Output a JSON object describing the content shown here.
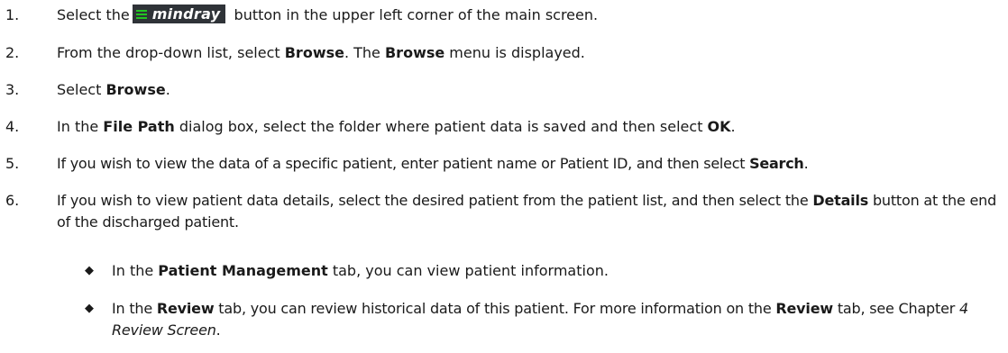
{
  "steps": [
    {
      "num": "1.",
      "pre": "Select the",
      "logo_text": "mindray",
      "post": "button in the upper left corner of the main screen."
    },
    {
      "num": "2.",
      "t1": "From the drop-down list, select ",
      "b1": "Browse",
      "t2": ". The ",
      "b2": "Browse",
      "t3": " menu is displayed."
    },
    {
      "num": "3.",
      "t1": "Select ",
      "b1": "Browse",
      "t2": "."
    },
    {
      "num": "4.",
      "t1": "In the ",
      "b1": "File Path",
      "t2": " dialog box, select the folder where patient data is saved and then select ",
      "b2": "OK",
      "t3": "."
    },
    {
      "num": "5.",
      "t1": "If you wish to view the data of a specific patient, enter patient name or Patient ID, and then select ",
      "b1": "Search",
      "t2": "."
    },
    {
      "num": "6.",
      "t1": "If you wish to view patient data details, select the desired patient from the patient list, and then select the ",
      "b1": "Details",
      "t2": " button at the end of the discharged patient."
    }
  ],
  "bullets": [
    {
      "t1": "In the ",
      "b1": "Patient Management",
      "t2": " tab, you can view patient information."
    },
    {
      "t1": "In the ",
      "b1": "Review",
      "t2": " tab, you can review historical data of this patient. For more information on the ",
      "b2": "Review",
      "t3": " tab, see Chapter ",
      "i1": "4 Review Screen",
      "t4": "."
    }
  ],
  "bullet_symbol": "◆",
  "colors": {
    "logo_bg": "#2f3338",
    "logo_menu": "#21c521"
  }
}
